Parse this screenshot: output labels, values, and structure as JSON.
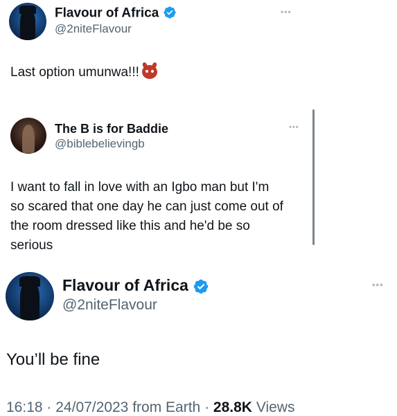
{
  "top_tweet": {
    "author_name": "Flavour of Africa",
    "author_handle": "@2niteFlavour",
    "more_icon": "ellipsis-icon",
    "text": "Last option umunwa!!!",
    "emoji": "devil-face-icon"
  },
  "quoted_tweet": {
    "author_name": "The B is for Baddie",
    "author_handle": "@biblebelievingb",
    "more_icon": "ellipsis-icon",
    "lines": [
      "I want to fall in love with an Igbo man but I'm",
      "so scared that one day he can just come out of",
      "the room dressed like this and he'd be so",
      "serious"
    ]
  },
  "reply_tweet": {
    "author_name": "Flavour of Africa",
    "author_handle": "@2niteFlavour",
    "more_icon": "ellipsis-icon",
    "text": "You’ll be fine",
    "meta": {
      "time": "16:18",
      "sep1": "·",
      "date": "24/07/2023",
      "source": "from Earth",
      "sep2": "·",
      "views_count": "28.8K",
      "views_label": "Views"
    }
  },
  "colors": {
    "verified_blue": "#1d9bf0",
    "text_primary": "#0f1419",
    "text_secondary": "#536471"
  }
}
